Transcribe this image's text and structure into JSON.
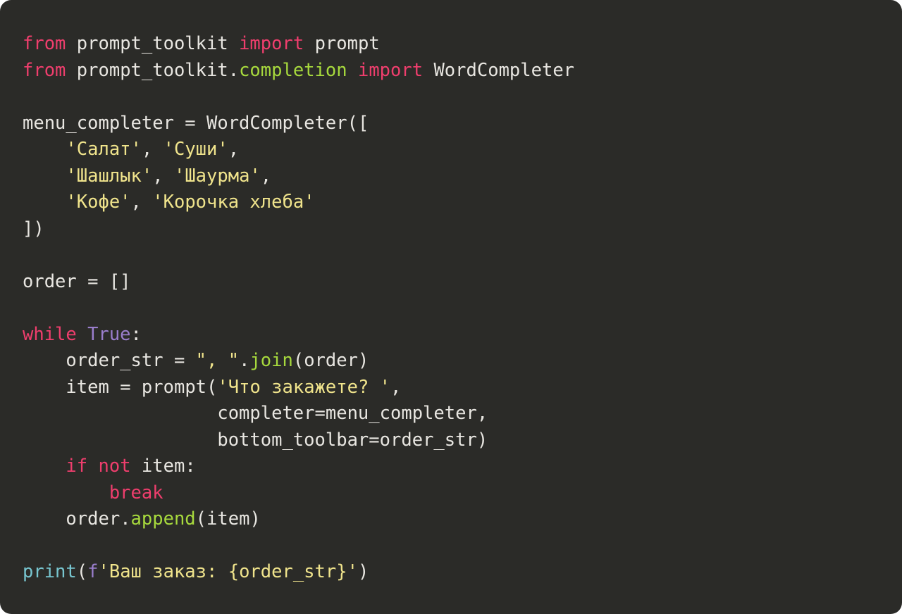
{
  "code": {
    "language": "python",
    "imports": [
      {
        "module": "prompt_toolkit",
        "names": [
          "prompt"
        ]
      },
      {
        "module": "prompt_toolkit.completion",
        "names": [
          "WordCompleter"
        ]
      }
    ],
    "menu_completer_items": [
      "Салат",
      "Суши",
      "Шашлык",
      "Шаурма",
      "Кофе",
      "Корочка хлеба"
    ],
    "order_init": "[]",
    "loop_condition": "True",
    "join_sep": ", ",
    "prompt_text": "Что закажете? ",
    "prompt_kwargs": {
      "completer": "menu_completer",
      "bottom_toolbar": "order_str"
    },
    "break_condition": "not item",
    "append_target": "order",
    "append_arg": "item",
    "final_print_fstring": "Ваш заказ: {order_str}"
  },
  "tokens": {
    "kw_from": "from",
    "kw_import": "import",
    "kw_while": "while",
    "kw_if": "if",
    "kw_not": "not",
    "kw_break": "break",
    "const_true": "True",
    "id_prompt_toolkit": "prompt_toolkit",
    "id_prompt": "prompt",
    "id_completion": "completion",
    "id_wordcompleter": "WordCompleter",
    "id_menu_completer": "menu_completer",
    "id_order": "order",
    "id_order_str": "order_str",
    "id_item": "item",
    "id_completer_kwarg": "completer",
    "id_bottom_toolbar_kwarg": "bottom_toolbar",
    "fn_join": "join",
    "fn_append": "append",
    "bi_print": "print",
    "str_salat": "'Салат'",
    "str_sushi": "'Суши'",
    "str_shashlyk": "'Шашлык'",
    "str_shaurma": "'Шаурма'",
    "str_kofe": "'Кофе'",
    "str_korochka": "'Корочка хлеба'",
    "str_joinsep": "\", \"",
    "str_prompt": "'Что закажете? '",
    "str_final": "'Ваш заказ: {order_str}'",
    "f_prefix": "f",
    "eq": " = ",
    "colon": ":",
    "dot": ".",
    "comma_sp": ", ",
    "comma": ",",
    "lparen": "(",
    "rparen": ")",
    "lbrack": "[",
    "rbrack": "]",
    "empty_list": "[]",
    "lbrack_rparen": "])"
  }
}
